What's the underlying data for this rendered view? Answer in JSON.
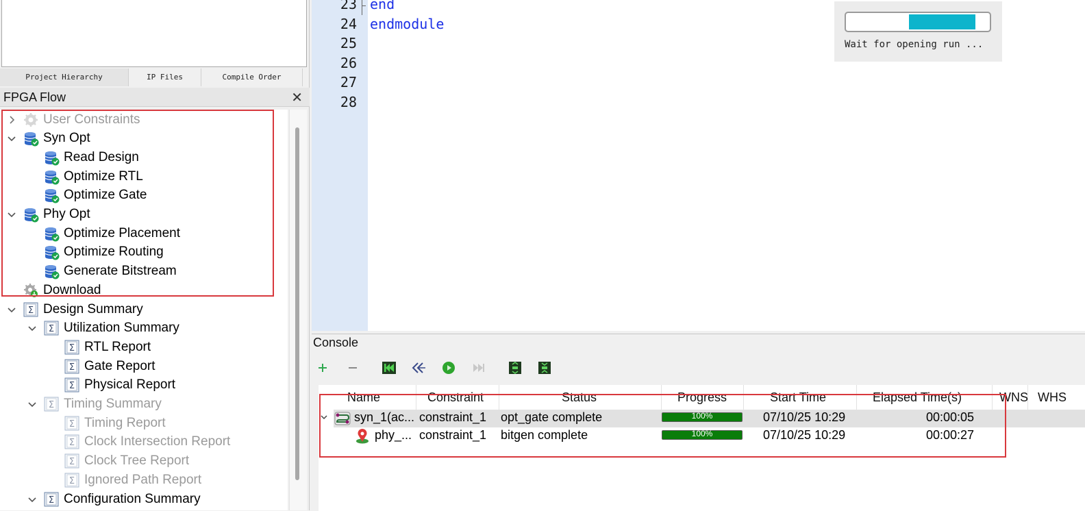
{
  "project_tabs": [
    "Project Hierarchy",
    "IP Files",
    "Compile Order"
  ],
  "fpga_flow": {
    "title": "FPGA Flow",
    "close_glyph": "✕",
    "items": [
      {
        "label": "User Constraints",
        "icon": "gear-icon",
        "expander": "collapsed",
        "level": 0,
        "dimmed": true
      },
      {
        "label": "Syn Opt",
        "icon": "database-check-icon",
        "expander": "expanded",
        "level": 0
      },
      {
        "label": "Read Design",
        "icon": "database-check-icon",
        "level": 1
      },
      {
        "label": "Optimize RTL",
        "icon": "database-check-icon",
        "level": 1
      },
      {
        "label": "Optimize Gate",
        "icon": "database-check-icon",
        "level": 1
      },
      {
        "label": "Phy Opt",
        "icon": "database-check-icon",
        "expander": "expanded",
        "level": 0
      },
      {
        "label": "Optimize Placement",
        "icon": "database-check-icon",
        "level": 1
      },
      {
        "label": "Optimize Routing",
        "icon": "database-check-icon",
        "level": 1
      },
      {
        "label": "Generate Bitstream",
        "icon": "database-check-icon",
        "level": 1
      },
      {
        "label": "Download",
        "icon": "gear-download-icon",
        "level": 0
      },
      {
        "label": "Design Summary",
        "icon": "sigma-report-icon",
        "expander": "expanded",
        "level": 0
      },
      {
        "label": "Utilization Summary",
        "icon": "sigma-report-icon",
        "expander": "expanded",
        "level": 1
      },
      {
        "label": "RTL Report",
        "icon": "sigma-report-icon",
        "level": 2
      },
      {
        "label": "Gate Report",
        "icon": "sigma-report-icon",
        "level": 2
      },
      {
        "label": "Physical Report",
        "icon": "sigma-report-icon",
        "level": 2
      },
      {
        "label": "Timing Summary",
        "icon": "sigma-report-icon",
        "expander": "expanded",
        "level": 1,
        "dimmed": true
      },
      {
        "label": "Timing Report",
        "icon": "sigma-report-icon",
        "level": 2,
        "dimmed": true
      },
      {
        "label": "Clock Intersection Report",
        "icon": "sigma-report-icon",
        "level": 2,
        "dimmed": true
      },
      {
        "label": "Clock Tree Report",
        "icon": "sigma-report-icon",
        "level": 2,
        "dimmed": true
      },
      {
        "label": "Ignored Path Report",
        "icon": "sigma-report-icon",
        "level": 2,
        "dimmed": true
      },
      {
        "label": "Configuration Summary",
        "icon": "sigma-report-icon",
        "expander": "expanded",
        "level": 1
      }
    ]
  },
  "editor": {
    "lines": [
      {
        "num": "23",
        "code": "end"
      },
      {
        "num": "24",
        "code": "endmodule"
      },
      {
        "num": "25",
        "code": ""
      },
      {
        "num": "26",
        "code": ""
      },
      {
        "num": "27",
        "code": ""
      },
      {
        "num": "28",
        "code": ""
      }
    ]
  },
  "progress_popup": {
    "text": "Wait for opening run ...",
    "indeterminate_segment_start": 0.44,
    "indeterminate_segment_end": 0.9
  },
  "console": {
    "title": "Console",
    "toolbar": [
      {
        "name": "add-run-icon",
        "glyph": "+"
      },
      {
        "name": "remove-run-icon",
        "glyph": "−"
      },
      {
        "name": "reset-run-icon"
      },
      {
        "name": "step-back-icon"
      },
      {
        "name": "launch-run-icon"
      },
      {
        "name": "skip-forward-icon"
      },
      {
        "name": "expand-all-icon"
      },
      {
        "name": "collapse-all-icon"
      }
    ],
    "columns": [
      "Name",
      "Constraint",
      "Status",
      "Progress",
      "Start Time",
      "Elapsed Time(s)",
      "WNS",
      "WHS"
    ],
    "runs": [
      {
        "name": "syn_1(ac...",
        "constraint": "constraint_1",
        "status": "opt_gate complete",
        "progress": "100%",
        "start_time": "07/10/25 10:29",
        "elapsed": "00:00:05",
        "icon": "synthesis-run-icon",
        "expanded": true
      },
      {
        "name": "phy_...",
        "constraint": "constraint_1",
        "status": "bitgen complete",
        "progress": "100%",
        "start_time": "07/10/25 10:29",
        "elapsed": "00:00:27",
        "icon": "implementation-run-icon"
      }
    ]
  },
  "colors": {
    "highlight_box": "#d8383d",
    "code_keyword": "#1d31e6",
    "progress_green": "#0a7d0a",
    "popup_progress": "#0db4cc",
    "gutter": "#dde8f7"
  }
}
